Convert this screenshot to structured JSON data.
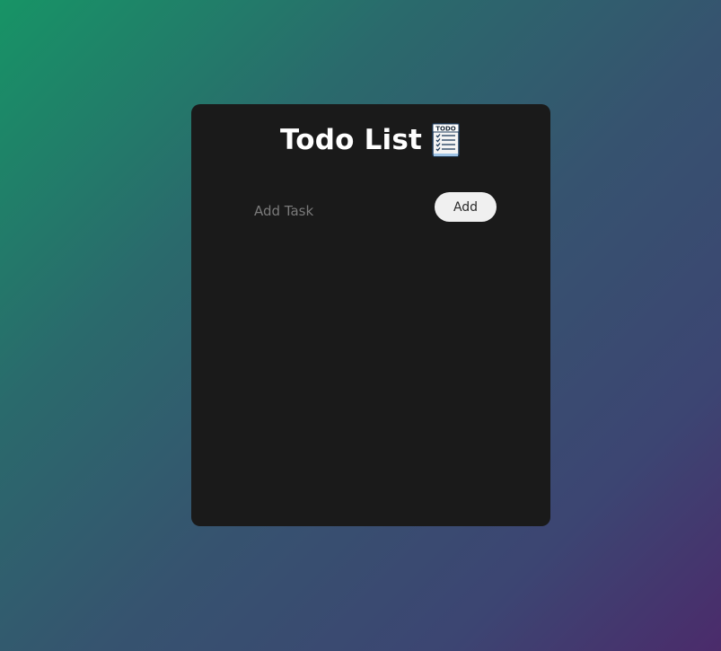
{
  "header": {
    "title": "Todo List",
    "icon": "todo-notepad-icon"
  },
  "form": {
    "input_value": "",
    "input_placeholder": "Add Task",
    "add_label": "Add"
  },
  "tasks": [],
  "colors": {
    "card_background": "#1a1a1a",
    "button_background": "#f0f0f0",
    "gradient_start": "#179466",
    "gradient_end": "#4b2b6b"
  }
}
